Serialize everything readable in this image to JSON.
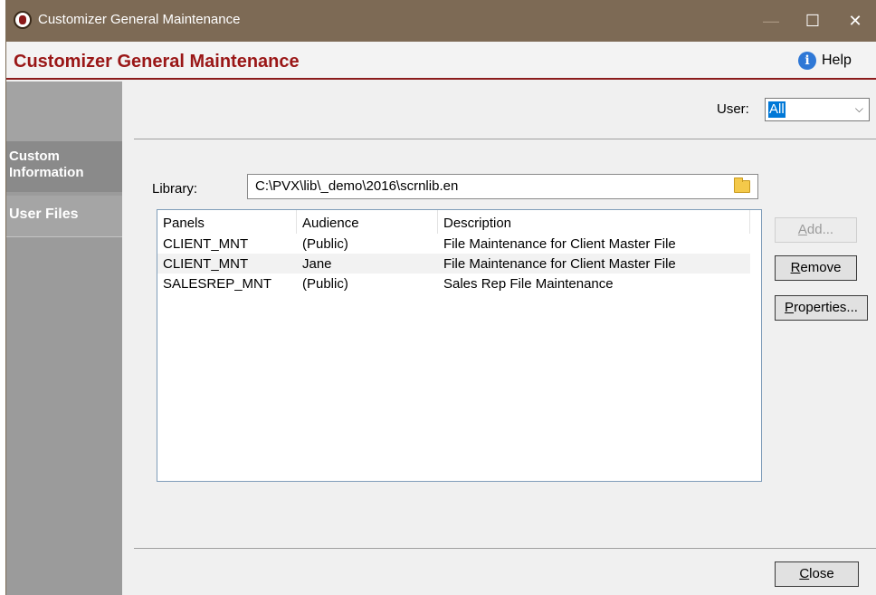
{
  "window": {
    "title": "Customizer General Maintenance",
    "minimize_glyph": "—",
    "maximize_glyph": "☐",
    "close_glyph": "✕"
  },
  "header": {
    "title": "Customizer General Maintenance",
    "help_label": "Help",
    "help_icon": "i"
  },
  "sidebar": {
    "items": [
      {
        "label": "Custom Information",
        "active": true
      },
      {
        "label": "User Files",
        "active": false
      }
    ]
  },
  "user_filter": {
    "label": "User:",
    "selected": "All",
    "chevron": "⌵"
  },
  "library": {
    "label": "Library:",
    "path": "C:\\PVX\\lib\\_demo\\2016\\scrnlib.en"
  },
  "panels_table": {
    "columns": [
      "Panels",
      "Audience",
      "Description"
    ],
    "rows": [
      [
        "CLIENT_MNT",
        "(Public)",
        "File Maintenance for Client Master File"
      ],
      [
        "CLIENT_MNT",
        "Jane",
        "File Maintenance for Client Master File"
      ],
      [
        "SALESREP_MNT",
        "(Public)",
        "Sales Rep File Maintenance"
      ]
    ],
    "selected_row": 1
  },
  "buttons": {
    "add": {
      "hotkey": "A",
      "rest": "dd..."
    },
    "remove": {
      "hotkey": "R",
      "rest": "emove"
    },
    "properties": {
      "hotkey": "P",
      "rest": "roperties..."
    },
    "close": {
      "hotkey": "C",
      "rest": "lose"
    }
  },
  "colors": {
    "titlebar": "#7d6a55",
    "header_title": "#9a1717",
    "sidebar": "#9b9b9b",
    "selection": "#0078d7"
  }
}
